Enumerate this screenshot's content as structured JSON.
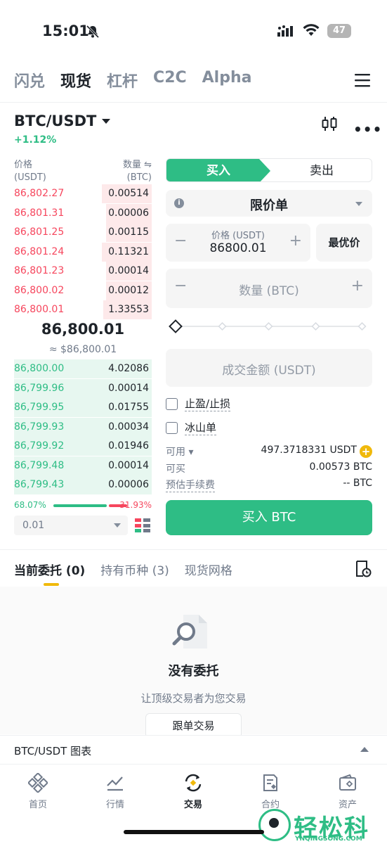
{
  "status_bar": {
    "time": "15:01",
    "battery": "47"
  },
  "top_nav": [
    "闪兑",
    "现货",
    "杠杆",
    "C2C",
    "Alpha"
  ],
  "top_nav_active": 1,
  "pair": {
    "symbol": "BTC/USDT",
    "change": "+1.12%"
  },
  "orderbook": {
    "price_header": "价格",
    "price_unit": "(USDT)",
    "qty_header": "数量 ⇋",
    "qty_unit": "(BTC)",
    "asks": [
      {
        "price": "86,802.27",
        "qty": "0.00514",
        "depth": 0.36
      },
      {
        "price": "86,801.31",
        "qty": "0.00006",
        "depth": 0.33
      },
      {
        "price": "86,801.25",
        "qty": "0.00115",
        "depth": 0.33
      },
      {
        "price": "86,801.24",
        "qty": "0.11321",
        "depth": 0.36
      },
      {
        "price": "86,801.23",
        "qty": "0.00014",
        "depth": 0.33
      },
      {
        "price": "86,800.02",
        "qty": "0.00012",
        "depth": 0.33
      },
      {
        "price": "86,800.01",
        "qty": "1.33553",
        "depth": 0.35
      }
    ],
    "mid_price": "86,800.01",
    "mid_fiat": "≈ $86,800.01",
    "bids": [
      {
        "price": "86,800.00",
        "qty": "4.02086",
        "depth": 1.0
      },
      {
        "price": "86,799.96",
        "qty": "0.00014",
        "depth": 1.0
      },
      {
        "price": "86,799.95",
        "qty": "0.01755",
        "depth": 1.0
      },
      {
        "price": "86,799.93",
        "qty": "0.00034",
        "depth": 1.0
      },
      {
        "price": "86,799.92",
        "qty": "0.01946",
        "depth": 1.0
      },
      {
        "price": "86,799.48",
        "qty": "0.00014",
        "depth": 1.0
      },
      {
        "price": "86,799.43",
        "qty": "0.00006",
        "depth": 1.0
      }
    ],
    "buy_ratio": "68.07%",
    "sell_ratio": "31.93%",
    "depth_precision": "0.01"
  },
  "order_form": {
    "buy_tab": "买入",
    "sell_tab": "卖出",
    "order_type": "限价单",
    "price_caption": "价格 (USDT)",
    "price_value": "86800.01",
    "best_price": "最优价",
    "qty_placeholder": "数量 (BTC)",
    "amount_placeholder": "成交金额 (USDT)",
    "tpsl": "止盈/止损",
    "iceberg": "冰山单",
    "available_label": "可用 ▾",
    "available_value": "497.3718331 USDT",
    "can_buy_label": "可买",
    "can_buy_value": "0.00573 BTC",
    "fee_label": "预估手续费",
    "fee_value": "-- BTC",
    "buy_button": "买入 BTC"
  },
  "orders_tabs": [
    "当前委托 (0)",
    "持有币种 (3)",
    "现货网格"
  ],
  "empty_state": {
    "title": "没有委托",
    "subtitle": "让顶级交易者为您交易",
    "button": "跟单交易"
  },
  "chart_bar": "BTC/USDT 图表",
  "bottom_nav": [
    "首页",
    "行情",
    "交易",
    "合约",
    "资产"
  ],
  "bottom_nav_active": 2,
  "watermark": {
    "cn": "轻松科技",
    "en": "YNQINGSONG.COM"
  },
  "colors": {
    "green": "#2ebd85",
    "red": "#f6465d",
    "yellow": "#f0b90b"
  }
}
